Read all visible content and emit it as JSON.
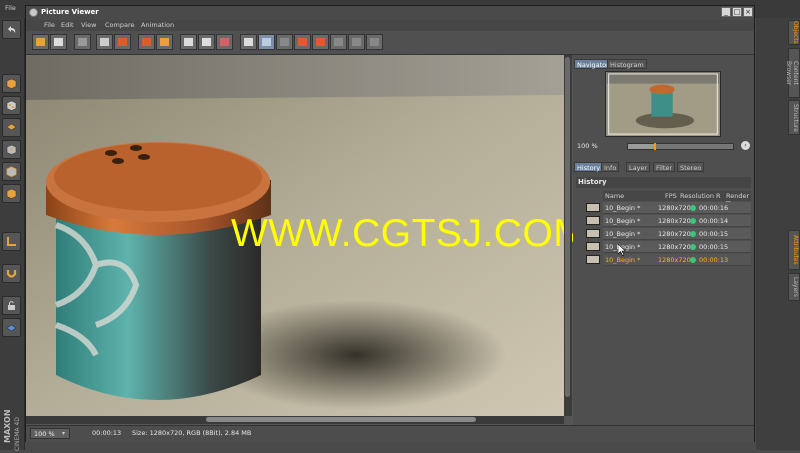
{
  "app": {
    "menu_file": "File",
    "attr_tab": "Attributes",
    "layers_tab": "Layers",
    "objects_tab": "Objects",
    "content_tab": "Content Browser",
    "structure_tab": "Structure",
    "brand": "MAXON",
    "product": "CINEMA 4D"
  },
  "window": {
    "title": "Picture Viewer"
  },
  "menu": [
    "File",
    "Edit",
    "View",
    "Compare",
    "Animation"
  ],
  "watermark": "WWW.CGTSJ.COM",
  "status": {
    "zoom": "100 %",
    "time": "00:00:13",
    "info": "Size: 1280x720, RGB (8Bit), 2.84 MB"
  },
  "navigator": {
    "tabs": [
      "Navigator",
      "Histogram"
    ],
    "zoom": "100 %",
    "zoom_value": 0.26
  },
  "history": {
    "tabs": [
      "History",
      "Info",
      "Layer",
      "Filter",
      "Stereo"
    ],
    "heading": "History",
    "columns": [
      "Name",
      "FPS",
      "Resolution",
      "R",
      "Render Time"
    ],
    "rows": [
      {
        "name": "10_Begin *",
        "resolution": "1280x720",
        "time": "00:00:16"
      },
      {
        "name": "10_Begin *",
        "resolution": "1280x720",
        "time": "00:00:14"
      },
      {
        "name": "10_Begin *",
        "resolution": "1280x720",
        "time": "00:00:15"
      },
      {
        "name": "10_Begin *",
        "resolution": "1280x720",
        "time": "00:00:15"
      },
      {
        "name": "10_Begin *",
        "resolution": "1280x720",
        "time": "00:00:13"
      }
    ]
  },
  "colors": {
    "accent": "#ff9a00",
    "status_ok": "#39c77a",
    "watermark": "#ffff00",
    "selected_text": "#ffb020"
  }
}
